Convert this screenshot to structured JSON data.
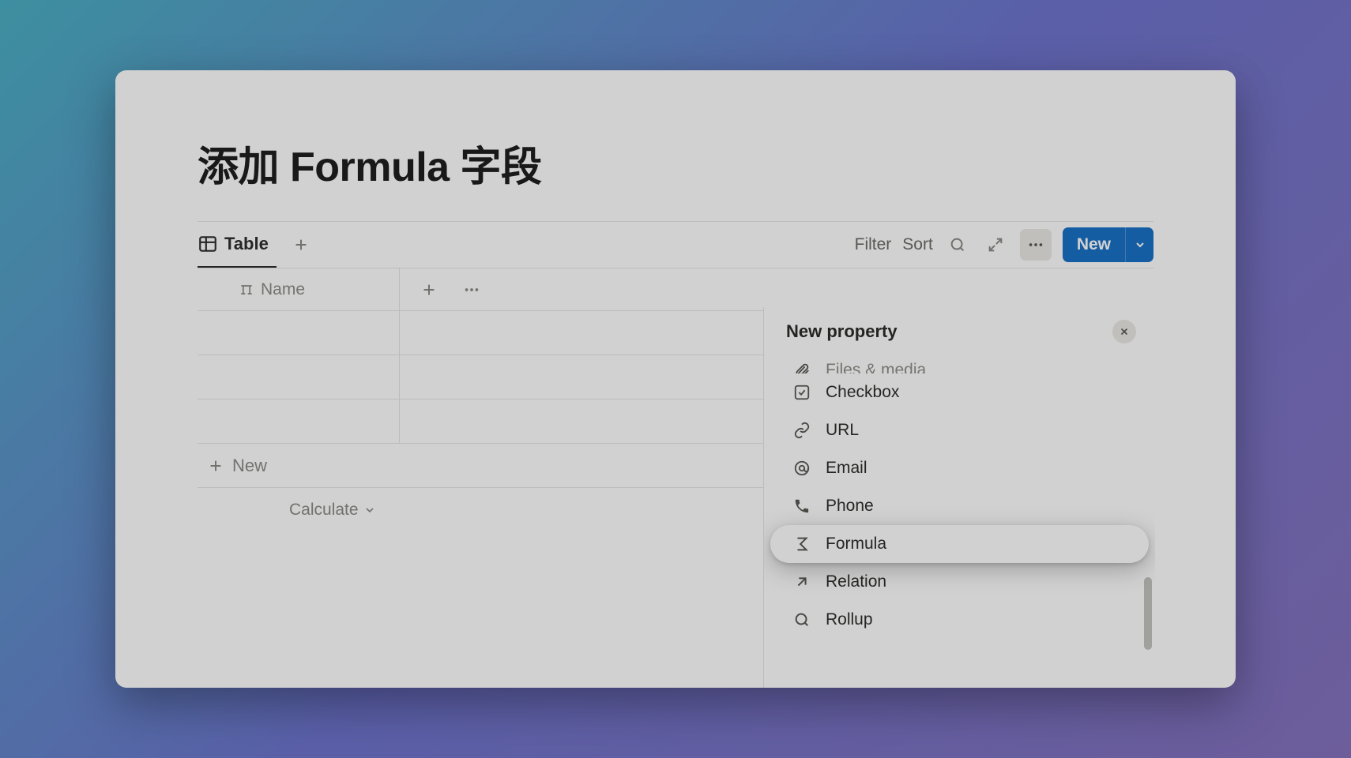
{
  "page": {
    "title": "添加 Formula 字段"
  },
  "view": {
    "tab_label": "Table",
    "filter": "Filter",
    "sort": "Sort",
    "new": "New"
  },
  "table": {
    "name_header": "Name",
    "add_row": "New",
    "calculate": "Calculate"
  },
  "popup": {
    "title": "New property",
    "items": [
      {
        "key": "files",
        "label": "Files & media",
        "highlight": false,
        "cut": true
      },
      {
        "key": "checkbox",
        "label": "Checkbox",
        "highlight": false,
        "cut": false
      },
      {
        "key": "url",
        "label": "URL",
        "highlight": false,
        "cut": false
      },
      {
        "key": "email",
        "label": "Email",
        "highlight": false,
        "cut": false
      },
      {
        "key": "phone",
        "label": "Phone",
        "highlight": false,
        "cut": false
      },
      {
        "key": "formula",
        "label": "Formula",
        "highlight": true,
        "cut": false
      },
      {
        "key": "relation",
        "label": "Relation",
        "highlight": false,
        "cut": false
      },
      {
        "key": "rollup",
        "label": "Rollup",
        "highlight": false,
        "cut": false
      }
    ]
  }
}
